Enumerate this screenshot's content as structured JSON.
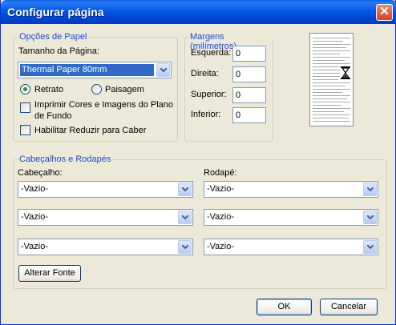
{
  "window": {
    "title": "Configurar página",
    "close_label": "✕"
  },
  "paper": {
    "legend": "Opções de Papel",
    "size_label": "Tamanho da Página:",
    "size_value": "Thermal Paper 80mm",
    "orientation": {
      "portrait": "Retrato",
      "landscape": "Paisagem",
      "selected": "portrait"
    },
    "print_bg_line1": "Imprimir Cores e Imagens do Plano",
    "print_bg_line2": "de Fundo",
    "shrink_to_fit": "Habilitar Reduzir para Caber"
  },
  "margins": {
    "legend": "Margens (milímetros)",
    "left_label": "Esquerda:",
    "left_value": "0",
    "right_label": "Direita:",
    "right_value": "0",
    "top_label": "Superior:",
    "top_value": "0",
    "bottom_label": "Inferior:",
    "bottom_value": "0"
  },
  "headers_footers": {
    "legend": "Cabeçalhos e Rodapés",
    "header_label": "Cabeçalho:",
    "footer_label": "Rodapé:",
    "header_values": [
      "-Vazio-",
      "-Vazio-",
      "-Vazio-"
    ],
    "footer_values": [
      "-Vazio-",
      "-Vazio-",
      "-Vazio-"
    ],
    "change_font": "Alterar Fonte"
  },
  "buttons": {
    "ok": "OK",
    "cancel": "Cancelar"
  },
  "icons": {
    "close": "close-icon",
    "dropdown": "chevron-down-icon",
    "hourglass": "hourglass-icon"
  },
  "colors": {
    "accent": "#316AC5",
    "group_title": "#1F49D3",
    "titlebar": "#0058E6"
  }
}
